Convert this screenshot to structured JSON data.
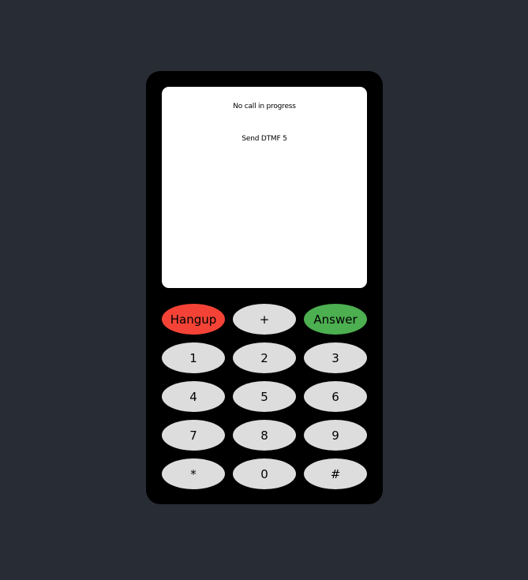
{
  "screen": {
    "status": "No call in progress",
    "last_action": "Send DTMF 5"
  },
  "keys": {
    "hangup": "Hangup",
    "plus": "+",
    "answer": "Answer",
    "k1": "1",
    "k2": "2",
    "k3": "3",
    "k4": "4",
    "k5": "5",
    "k6": "6",
    "k7": "7",
    "k8": "8",
    "k9": "9",
    "star": "*",
    "k0": "0",
    "hash": "#"
  },
  "colors": {
    "background": "#282c34",
    "phone_body": "#000000",
    "screen": "#ffffff",
    "key": "#dddddd",
    "hangup": "#f44336",
    "answer": "#4caf50"
  }
}
